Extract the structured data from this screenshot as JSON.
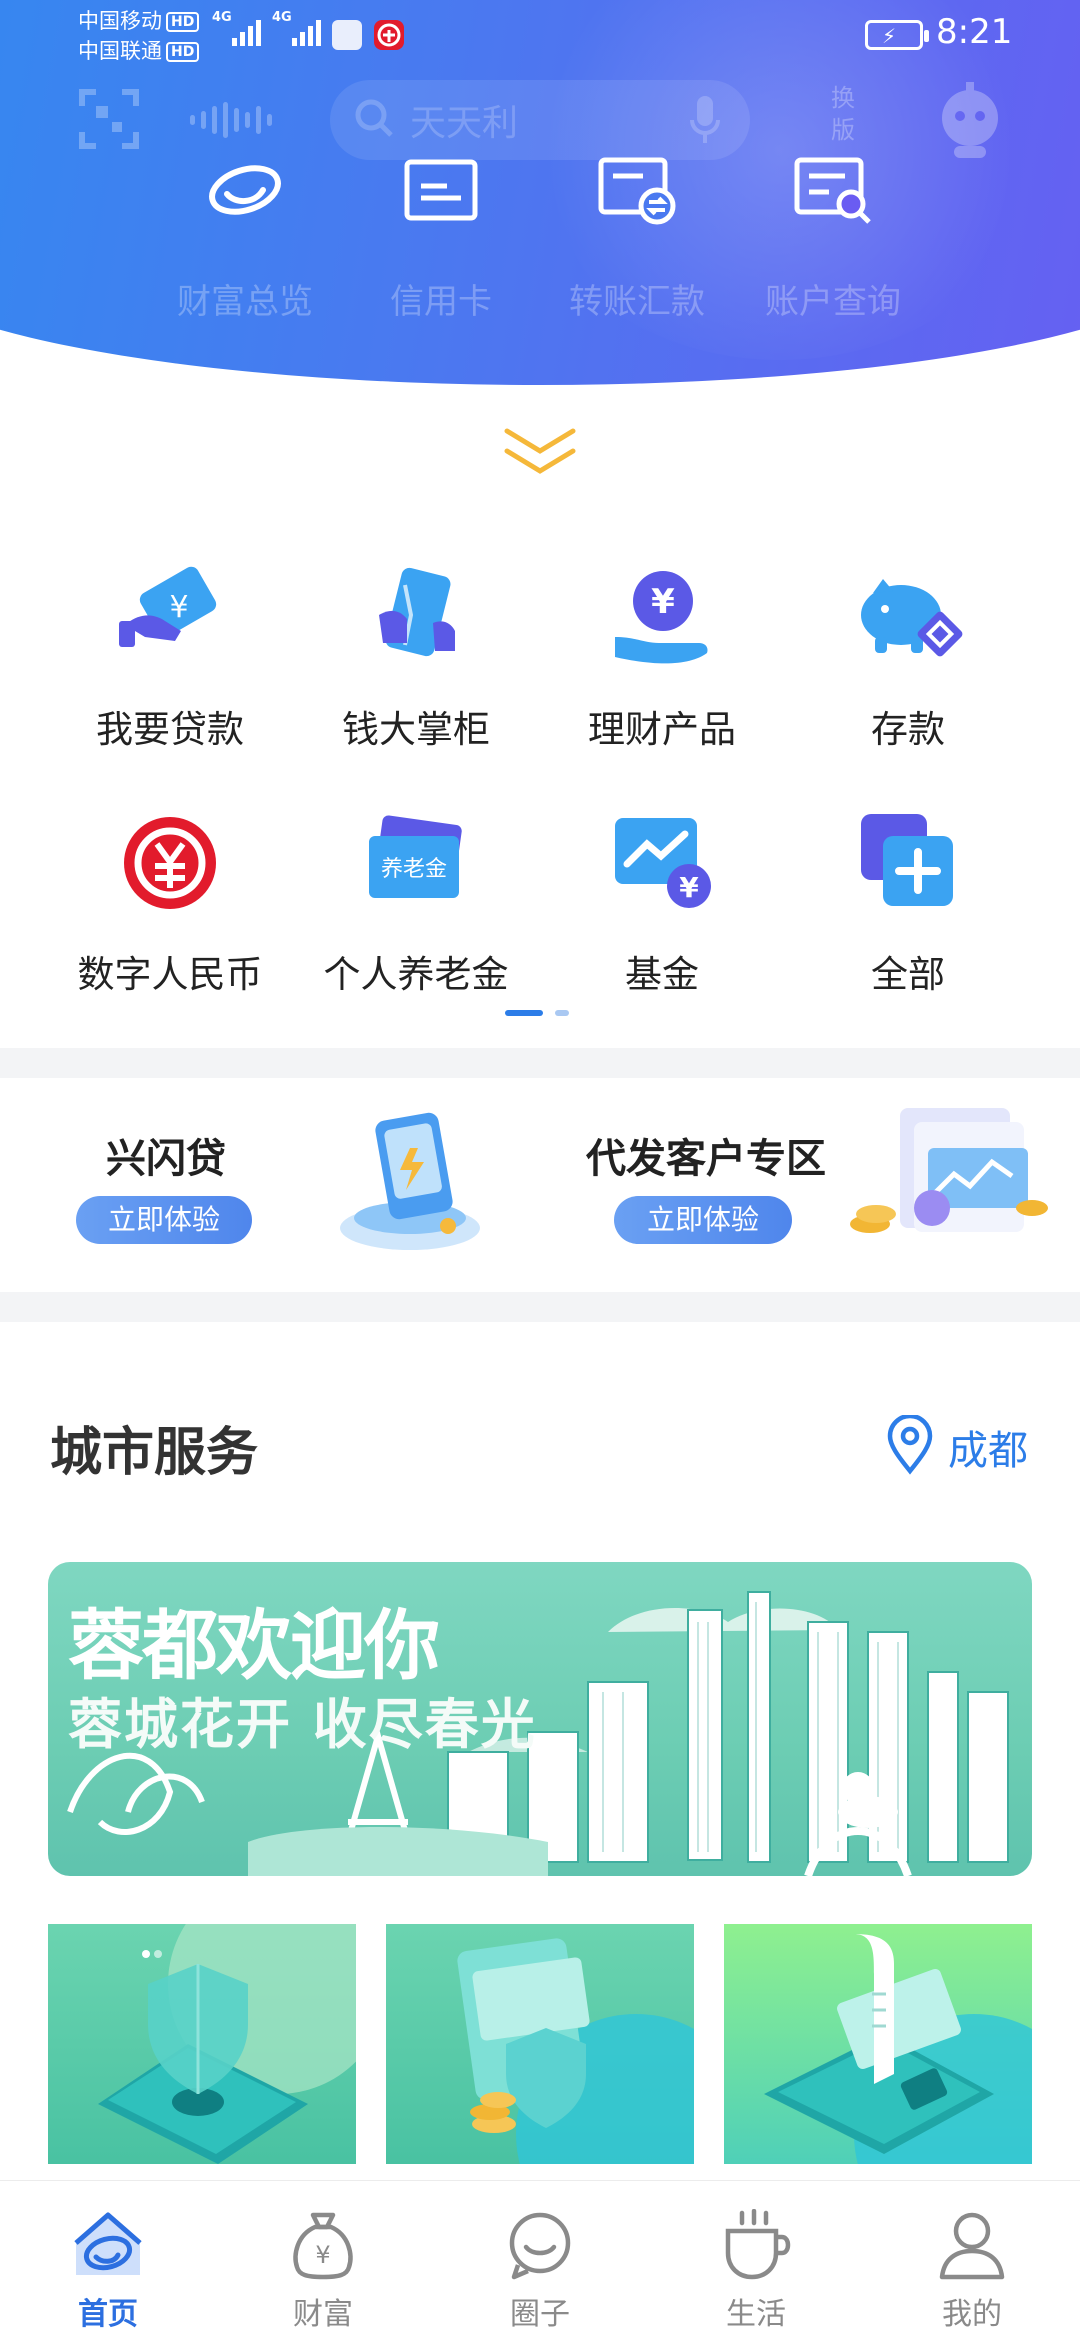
{
  "status_bar": {
    "carrier1": "中国移动",
    "carrier2": "中国联通",
    "hd": "HD",
    "network": "4G",
    "time": "8:21"
  },
  "header": {
    "search_placeholder": "天天利",
    "switch_version_line1": "换",
    "switch_version_line2": "版",
    "quick_actions": [
      {
        "label": "财富总览",
        "icon": "wealth-overview-icon"
      },
      {
        "label": "信用卡",
        "icon": "credit-card-icon"
      },
      {
        "label": "转账汇款",
        "icon": "transfer-icon"
      },
      {
        "label": "账户查询",
        "icon": "account-query-icon"
      }
    ]
  },
  "grid": {
    "items": [
      {
        "label": "我要贷款",
        "icon": "loan-icon"
      },
      {
        "label": "钱大掌柜",
        "icon": "qiandazhanggui-icon"
      },
      {
        "label": "理财产品",
        "icon": "wealth-product-icon"
      },
      {
        "label": "存款",
        "icon": "piggy-bank-icon"
      },
      {
        "label": "数字人民币",
        "icon": "digital-rmb-icon"
      },
      {
        "label": "个人养老金",
        "icon": "pension-icon"
      },
      {
        "label": "基金",
        "icon": "fund-icon"
      },
      {
        "label": "全部",
        "icon": "all-services-icon"
      }
    ],
    "pension_card_text": "养老金",
    "page_count": 2,
    "active_page": 1
  },
  "promos": [
    {
      "title": "兴闪贷",
      "button": "立即体验"
    },
    {
      "title": "代发客户专区",
      "button": "立即体验"
    }
  ],
  "city_service": {
    "title": "城市服务",
    "city": "成都",
    "banner_title": "蓉都欢迎你",
    "banner_subtitle": "蓉城花开 收尽春光"
  },
  "bottom_nav": {
    "items": [
      {
        "label": "首页",
        "icon": "home-icon",
        "active": true
      },
      {
        "label": "财富",
        "icon": "wealth-bag-icon",
        "active": false
      },
      {
        "label": "圈子",
        "icon": "circle-chat-icon",
        "active": false
      },
      {
        "label": "生活",
        "icon": "coffee-cup-icon",
        "active": false
      },
      {
        "label": "我的",
        "icon": "profile-icon",
        "active": false
      }
    ]
  },
  "colors": {
    "header_gradient_start": "#2f8cf0",
    "header_gradient_end": "#6a5cf2",
    "accent_blue": "#2c6fe0",
    "chevron": "#f5b83a"
  }
}
